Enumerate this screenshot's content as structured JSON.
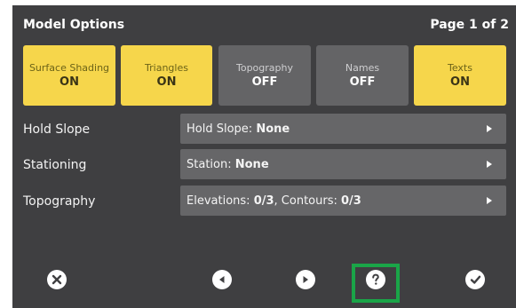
{
  "header": {
    "title": "Model Options",
    "page_indicator": "Page 1 of 2"
  },
  "toggles": [
    {
      "label": "Surface Shading",
      "state": "ON"
    },
    {
      "label": "Triangles",
      "state": "ON"
    },
    {
      "label": "Topography",
      "state": "OFF"
    },
    {
      "label": "Names",
      "state": "OFF"
    },
    {
      "label": "Texts",
      "state": "ON"
    }
  ],
  "rows": [
    {
      "label": "Hold Slope",
      "field_prefix": "Hold Slope:",
      "field_value": "None"
    },
    {
      "label": "Stationing",
      "field_prefix": "Station:",
      "field_value": "None"
    },
    {
      "label": "Topography",
      "field_prefix": "Elevations:",
      "field_value": "0/3",
      "field_sep": ", Contours:",
      "field_value2": "0/3"
    }
  ],
  "footer": {
    "icons": [
      "close-icon",
      "previous-icon",
      "next-icon",
      "help-icon",
      "confirm-icon"
    ],
    "help_highlight_color": "#1aa548"
  },
  "colors": {
    "toggle_on": "#f6d64b",
    "toggle_off": "#646466",
    "panel": "#3f3f41"
  }
}
